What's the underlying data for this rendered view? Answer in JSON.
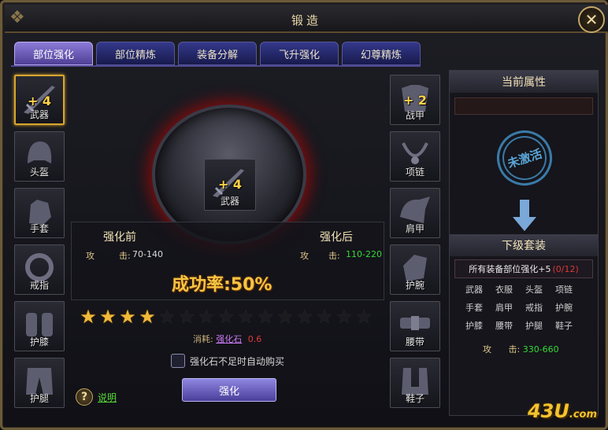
{
  "window": {
    "title": "锻造",
    "close_symbol": "✕"
  },
  "tabs": [
    "部位强化",
    "部位精炼",
    "装备分解",
    "飞升强化",
    "幻尊精炼"
  ],
  "left_slots": [
    {
      "name": "武器",
      "level": "+ 4",
      "selected": true,
      "icon": "sword-icon"
    },
    {
      "name": "头盔",
      "level": "",
      "icon": "helmet-icon"
    },
    {
      "name": "手套",
      "level": "",
      "icon": "glove-icon"
    },
    {
      "name": "戒指",
      "level": "",
      "icon": "ring-icon"
    },
    {
      "name": "护膝",
      "level": "",
      "icon": "kneepad-icon"
    },
    {
      "name": "护腿",
      "level": "",
      "icon": "leggings-icon"
    }
  ],
  "right_slots": [
    {
      "name": "战甲",
      "level": "+ 2",
      "icon": "armor-icon"
    },
    {
      "name": "项链",
      "level": "",
      "icon": "necklace-icon"
    },
    {
      "name": "肩甲",
      "level": "",
      "icon": "shoulder-icon"
    },
    {
      "name": "护腕",
      "level": "",
      "icon": "bracer-icon"
    },
    {
      "name": "腰带",
      "level": "",
      "icon": "belt-icon"
    },
    {
      "name": "鞋子",
      "level": "",
      "icon": "boots-icon"
    }
  ],
  "center_item": {
    "name": "武器",
    "level": "+ 4",
    "icon": "sword-icon"
  },
  "compare": {
    "before_title": "强化前",
    "after_title": "强化后",
    "attack_label": "攻",
    "attack_sub": "击:",
    "before_value": "70-140",
    "after_value": "110-220"
  },
  "success_rate": "成功率:50%",
  "stars": {
    "filled": 4,
    "total": 15
  },
  "cost": {
    "label": "消耗:",
    "item": "强化石",
    "amount": "0.6"
  },
  "auto_buy_label": "强化石不足时自动购买",
  "strengthen_button": "强化",
  "help_label": "说明",
  "right_panel": {
    "current_attr_title": "当前属性",
    "seal_text": "未激活",
    "next_set_title": "下级套装",
    "set_requirement": "所有装备部位强化+5",
    "set_progress": "(0/12)",
    "parts": [
      "武器",
      "衣服",
      "头盔",
      "项链",
      "手套",
      "肩甲",
      "戒指",
      "护腕",
      "护膝",
      "腰带",
      "护腿",
      "鞋子"
    ],
    "bonus_label": "攻",
    "bonus_sub": "击:",
    "bonus_value": "330-660"
  },
  "watermark": {
    "main": "43U",
    "suffix": ".com"
  },
  "colors": {
    "gold": "#d7a62f",
    "green_value": "#38d838",
    "tab_active": "#8b7bd8",
    "progress_red": "#d83a3a"
  }
}
